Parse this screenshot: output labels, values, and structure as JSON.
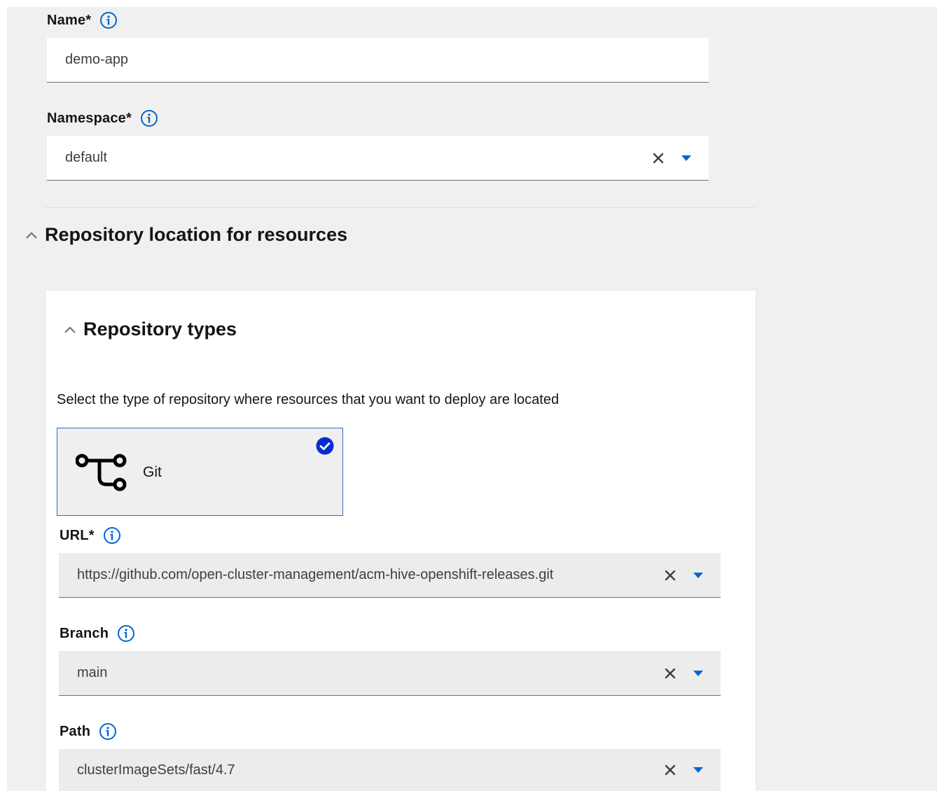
{
  "form": {
    "name": {
      "label": "Name*",
      "value": "demo-app",
      "info_icon": "info-circle-icon"
    },
    "namespace": {
      "label": "Namespace*",
      "value": "default",
      "info_icon": "info-circle-icon"
    }
  },
  "repository_location": {
    "title": "Repository location for resources",
    "expanded": true
  },
  "repository_types": {
    "title": "Repository types",
    "expanded": true,
    "description": "Select the type of repository where resources that you want to deploy are located",
    "options": [
      {
        "label": "Git",
        "icon": "git-branch-icon",
        "selected": true
      }
    ]
  },
  "git": {
    "url": {
      "label": "URL*",
      "value": "https://github.com/open-cluster-management/acm-hive-openshift-releases.git"
    },
    "branch": {
      "label": "Branch",
      "value": "main"
    },
    "path": {
      "label": "Path",
      "value": "clusterImageSets/fast/4.7"
    }
  },
  "colors": {
    "accent": "#0066cc",
    "tile_border": "#2b6cc4",
    "page_background": "#f0f0f0",
    "field_underline": "#6a6e73"
  }
}
